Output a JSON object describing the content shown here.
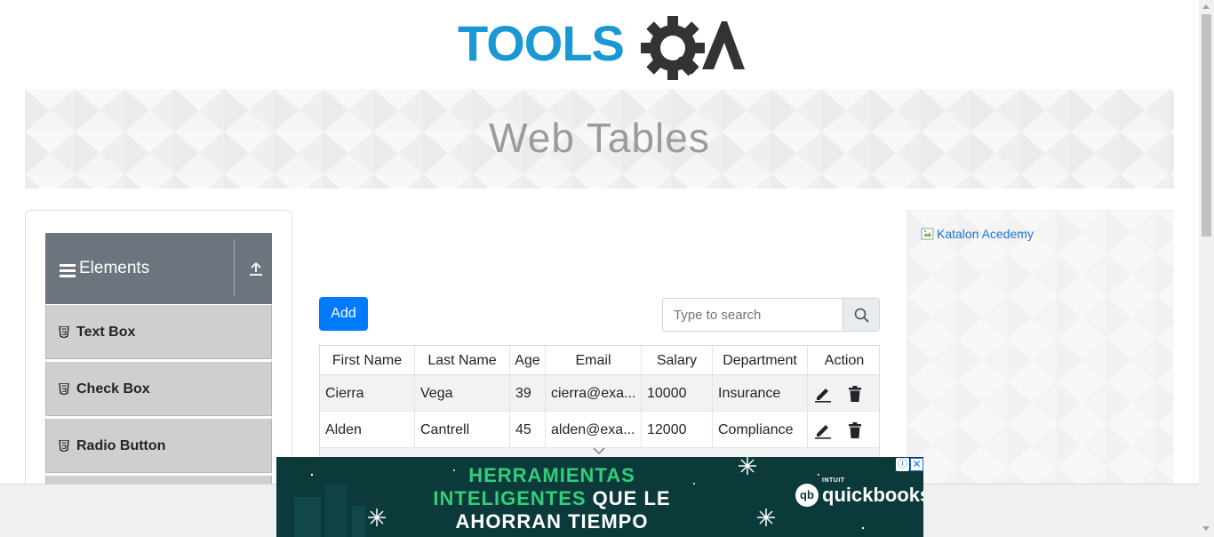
{
  "header": {
    "logo_text": "TOOLSQA"
  },
  "banner": {
    "title": "Web Tables"
  },
  "sidebar": {
    "group_title": "Elements",
    "items": [
      {
        "label": "Text Box"
      },
      {
        "label": "Check Box"
      },
      {
        "label": "Radio Button"
      }
    ]
  },
  "controls": {
    "add_label": "Add",
    "search_placeholder": "Type to search"
  },
  "table": {
    "columns": [
      "First Name",
      "Last Name",
      "Age",
      "Email",
      "Salary",
      "Department",
      "Action"
    ],
    "rows": [
      {
        "first": "Cierra",
        "last": "Vega",
        "age": "39",
        "email": "cierra@exa...",
        "salary": "10000",
        "department": "Insurance"
      },
      {
        "first": "Alden",
        "last": "Cantrell",
        "age": "45",
        "email": "alden@exa...",
        "salary": "12000",
        "department": "Compliance"
      }
    ]
  },
  "right_panel": {
    "image_alt": "Katalon Acedemy"
  },
  "ad": {
    "line1": "HERRAMIENTAS",
    "line2_green": "INTELIGENTES",
    "line2_white": " QUE LE",
    "line3": "AHORRAN TIEMPO",
    "brand": "quickbooks",
    "brand_small": "INTUIT",
    "brand_mark": "qb",
    "info_glyph": "ⓘ",
    "close_glyph": "✕"
  },
  "colors": {
    "accent": "#007bff",
    "logo_blue": "#1a98d6",
    "logo_dark": "#333333",
    "sidebar_header": "#6c757d",
    "ad_green": "#2fd07a",
    "ad_bg": "#0c3a3a"
  },
  "icons": {
    "menu": "hamburger-icon",
    "upload": "upload-icon",
    "item": "html5-icon",
    "search": "magnifier-icon",
    "edit": "pencil-icon",
    "delete": "trash-icon"
  }
}
